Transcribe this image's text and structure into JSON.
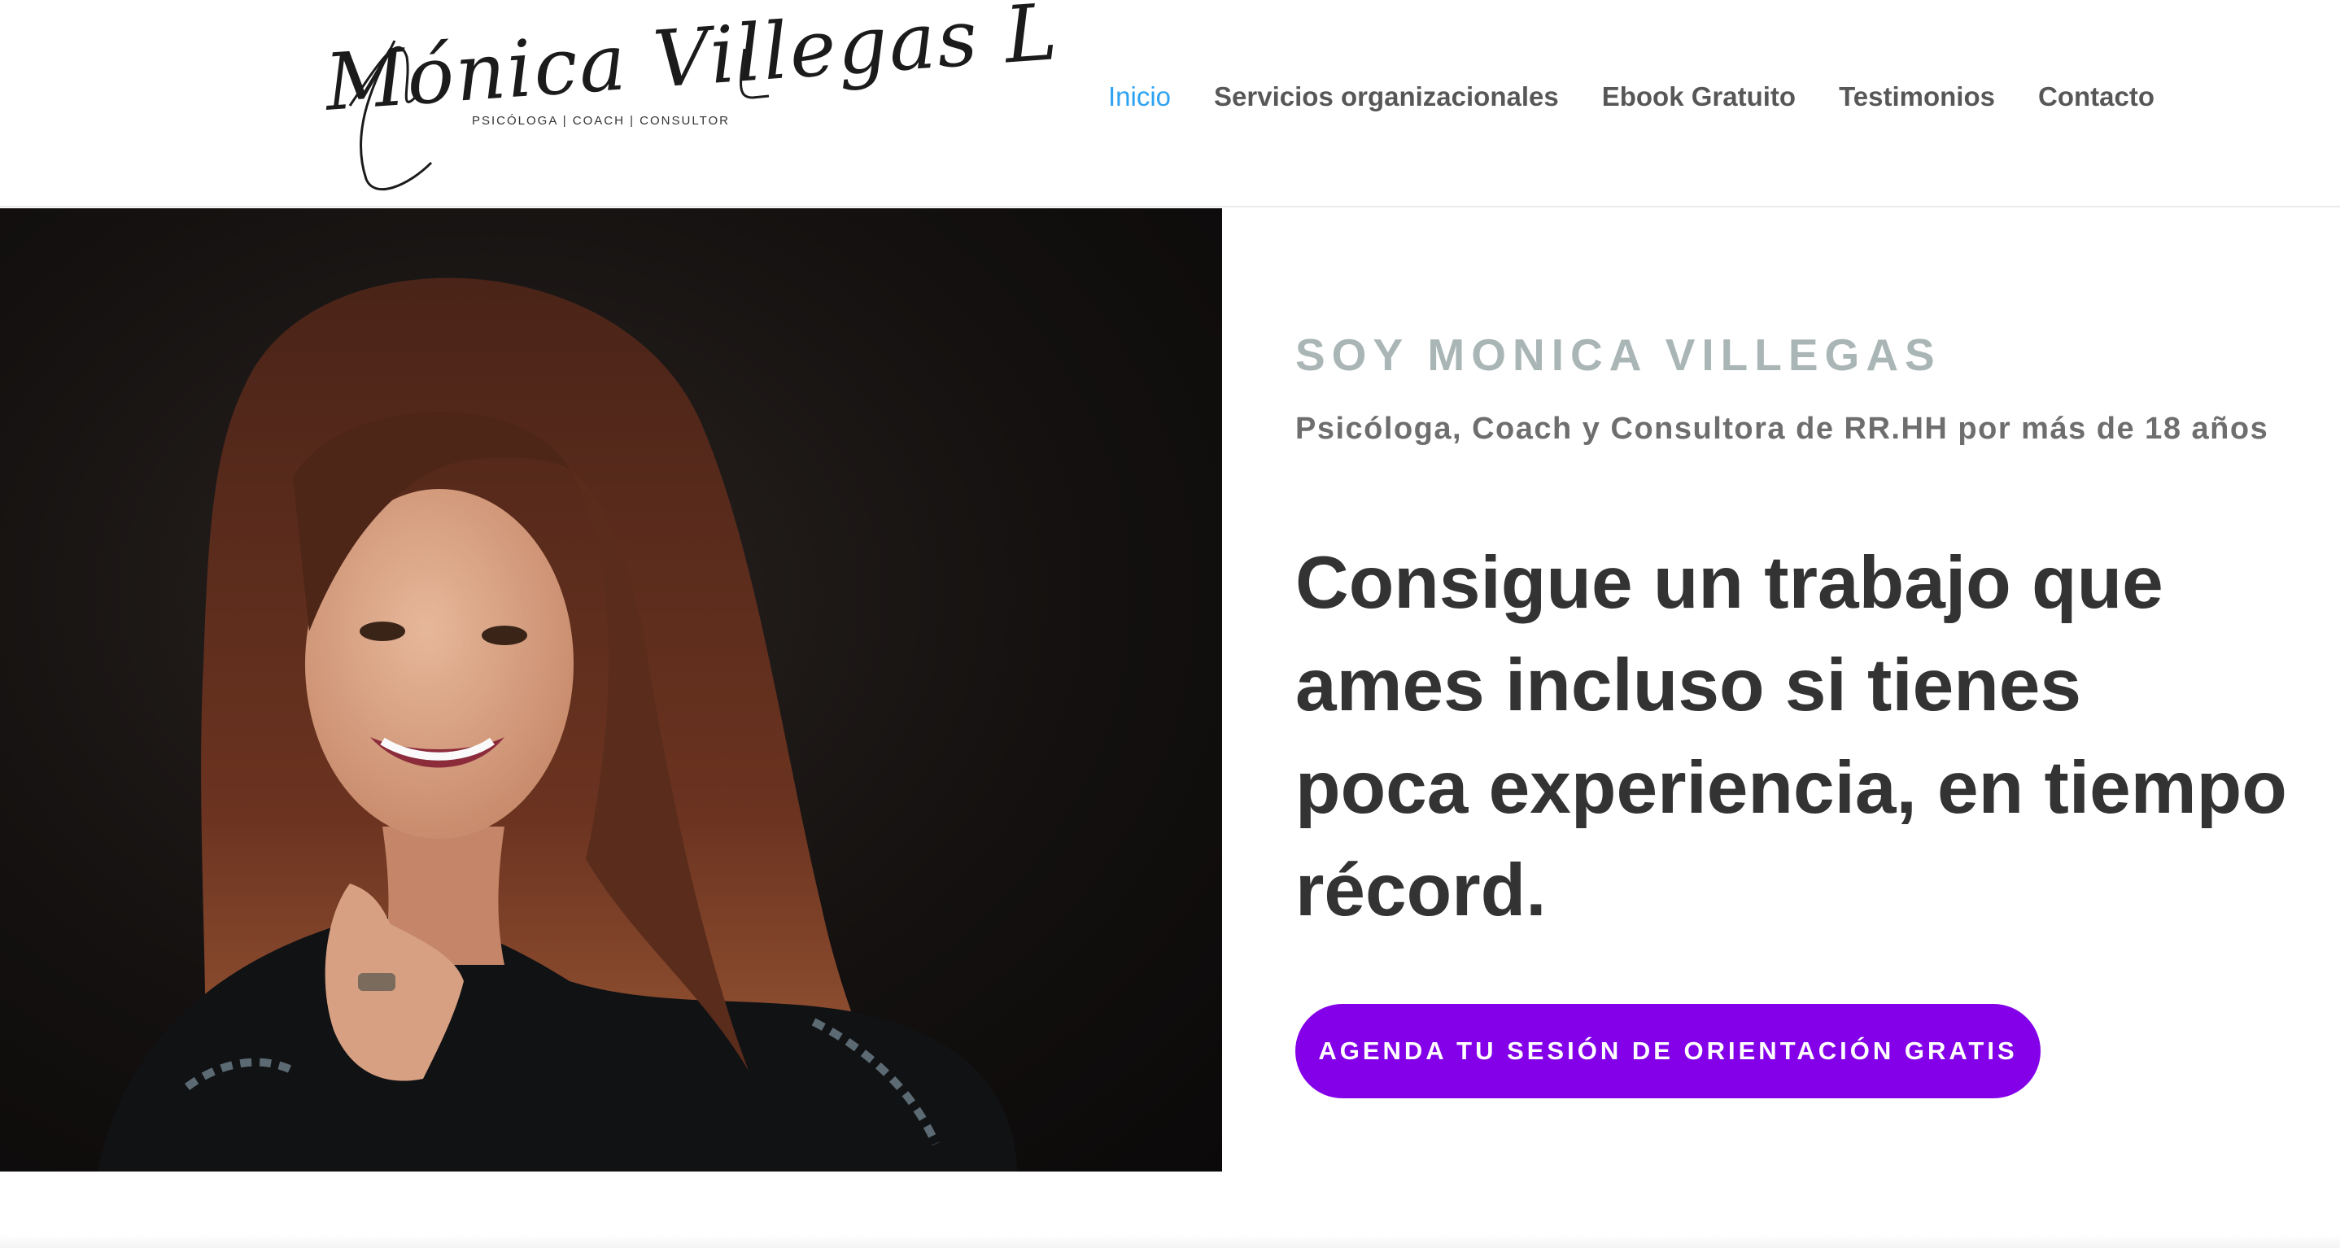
{
  "header": {
    "logo": {
      "script_text": "Mónica Villegas L",
      "tagline": "PSICÓLOGA | COACH | CONSULTOR"
    },
    "nav": [
      {
        "label": "Inicio",
        "active": true
      },
      {
        "label": "Servicios organizacionales",
        "active": false
      },
      {
        "label": "Ebook Gratuito",
        "active": false
      },
      {
        "label": "Testimonios",
        "active": false
      },
      {
        "label": "Contacto",
        "active": false
      }
    ]
  },
  "hero": {
    "eyebrow": "SOY MONICA VILLEGAS",
    "subtitle": "Psicóloga, Coach y Consultora de RR.HH por más de 18 años",
    "headline_lines": [
      "Consigue un trabajo que",
      "ames incluso si tienes",
      "poca experiencia, en tiempo",
      "récord."
    ],
    "cta_label": "AGENDA TU SESIÓN DE ORIENTACIÓN GRATIS"
  },
  "colors": {
    "nav_active": "#2ea3f2",
    "nav_text": "#666666",
    "eyebrow": "#a9b6b5",
    "subtitle": "#6e6e6e",
    "headline": "#333333",
    "cta_bg": "#8300e9",
    "photo_bg": "#141110"
  }
}
